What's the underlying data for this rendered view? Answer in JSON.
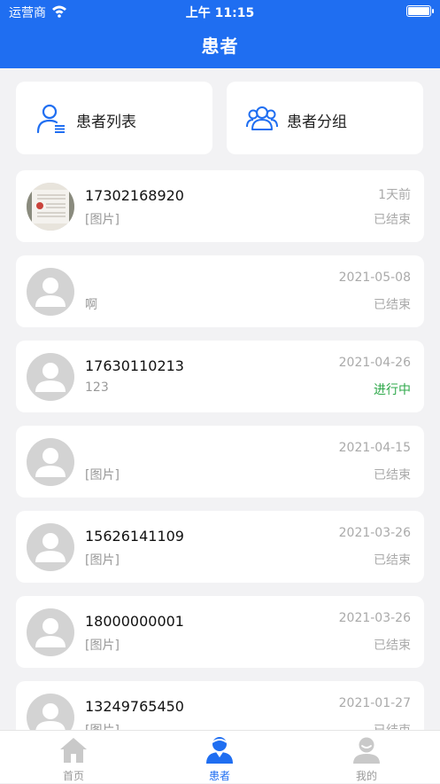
{
  "status_bar": {
    "carrier": "运营商",
    "time": "上午 11:15"
  },
  "header": {
    "title": "患者"
  },
  "quick_actions": [
    {
      "label": "患者列表",
      "icon": "patient-list-icon"
    },
    {
      "label": "患者分组",
      "icon": "patient-group-icon"
    }
  ],
  "patients": [
    {
      "phone": "17302168920",
      "message": "[图片]",
      "date": "1天前",
      "status": "已结束",
      "avatar": "photo"
    },
    {
      "phone": "",
      "message": "啊",
      "date": "2021-05-08",
      "status": "已结束",
      "avatar": "default"
    },
    {
      "phone": "17630110213",
      "message": "123",
      "date": "2021-04-26",
      "status": "进行中",
      "avatar": "default"
    },
    {
      "phone": "",
      "message": "[图片]",
      "date": "2021-04-15",
      "status": "已结束",
      "avatar": "default"
    },
    {
      "phone": "15626141109",
      "message": "[图片]",
      "date": "2021-03-26",
      "status": "已结束",
      "avatar": "default"
    },
    {
      "phone": "18000000001",
      "message": "[图片]",
      "date": "2021-03-26",
      "status": "已结束",
      "avatar": "default"
    },
    {
      "phone": "13249765450",
      "message": "[图片]",
      "date": "2021-01-27",
      "status": "已结束",
      "avatar": "default"
    }
  ],
  "tabbar": {
    "items": [
      {
        "label": "首页",
        "icon": "home-icon",
        "active": false
      },
      {
        "label": "患者",
        "icon": "patient-icon",
        "active": true
      },
      {
        "label": "我的",
        "icon": "profile-icon",
        "active": false
      }
    ]
  },
  "colors": {
    "brand": "#1f6ef1",
    "in_progress": "#2ea84a",
    "muted": "#aaaaaa"
  }
}
